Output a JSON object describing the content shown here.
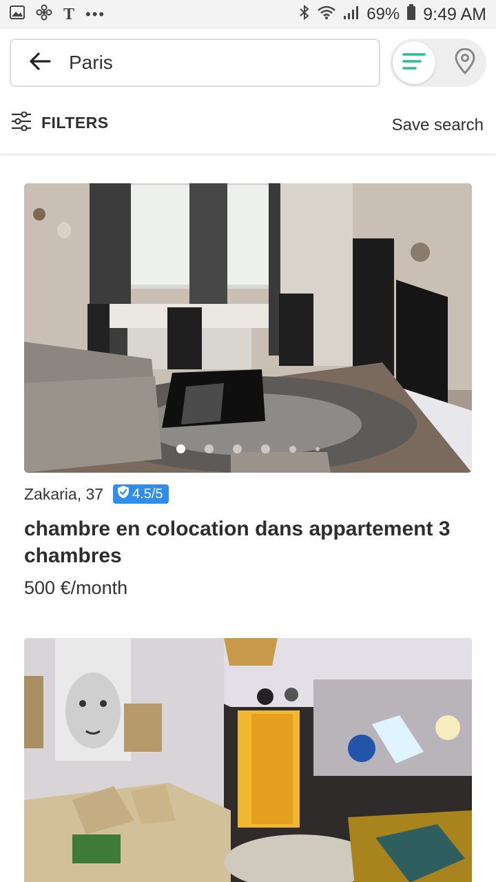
{
  "status_bar": {
    "left_icons": [
      "gallery-icon",
      "fan-icon",
      "t-icon",
      "more-icon"
    ],
    "battery": "69%",
    "time": "9:49 AM"
  },
  "search": {
    "value": "Paris"
  },
  "view_toggle": {
    "active": "list"
  },
  "filters": {
    "label": "FILTERS",
    "save_label": "Save search"
  },
  "listings": [
    {
      "host": "Zakaria, 37",
      "rating": "4.5/5",
      "title": "chambre en colocation dans appartement 3 chambres",
      "price": "500 €/month",
      "photo_count_dots": 6,
      "active_photo": 1
    },
    {
      "photo_count_dots": 0
    }
  ],
  "colors": {
    "accent_green": "#25c08a",
    "badge_blue": "#2f8df0"
  }
}
